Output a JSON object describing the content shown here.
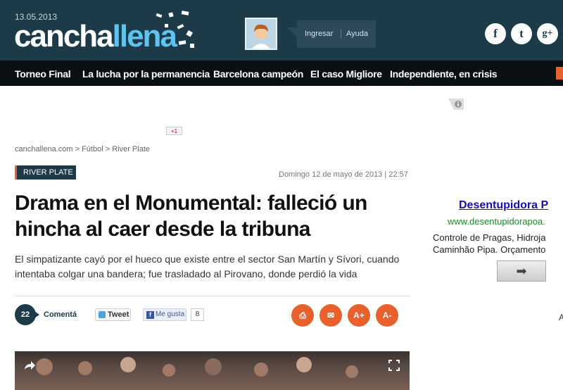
{
  "header": {
    "date": "13.05.2013",
    "logo_part1": "cancha",
    "logo_part2": "llena",
    "login": "Ingresar",
    "help": "Ayuda",
    "social": {
      "facebook": "f",
      "twitter": "t",
      "gplus": "g+"
    }
  },
  "nav": {
    "items": [
      {
        "label": "Torneo Final"
      },
      {
        "label": "La lucha por la permanencia"
      },
      {
        "label": "Barcelona campeón"
      },
      {
        "label": "El caso Migliore"
      },
      {
        "label": "Independiente, en crisis"
      }
    ]
  },
  "share_top": {
    "gplus_label": "+1"
  },
  "breadcrumb": "canchallena.com > Fútbol > River Plate",
  "article": {
    "section": "RIVER PLATE",
    "date": "Domingo 12 de mayo de 2013 | 22:57",
    "title": "Drama en el Monumental: falleció un hincha al caer desde la tribuna",
    "summary": "El simpatizante cayó por el hueco que existe entre el sector San Martín y Sívori, cuando intentaba colgar una bandera; fue trasladado al Pirovano, donde perdió la vida",
    "comments_count": "22",
    "comment_label": "Comentá",
    "tweet_label": "Tweet",
    "like_label": "Me gusta",
    "like_count": "8",
    "tools": {
      "print": "⎙",
      "email": "✉",
      "font_up": "A+",
      "font_down": "A-"
    }
  },
  "ad": {
    "title": "Desentupidora P",
    "url": "www.desentupidorapoa.",
    "desc_line1": "Controle de Pragas, Hidroja",
    "desc_line2": "Caminhão Pipa. Orçamento",
    "arrow": "➡",
    "edge_text": "A"
  },
  "colors": {
    "header_bg": "#1c3a48",
    "accent": "#e8612c",
    "logo_accent": "#5ec4ef"
  }
}
